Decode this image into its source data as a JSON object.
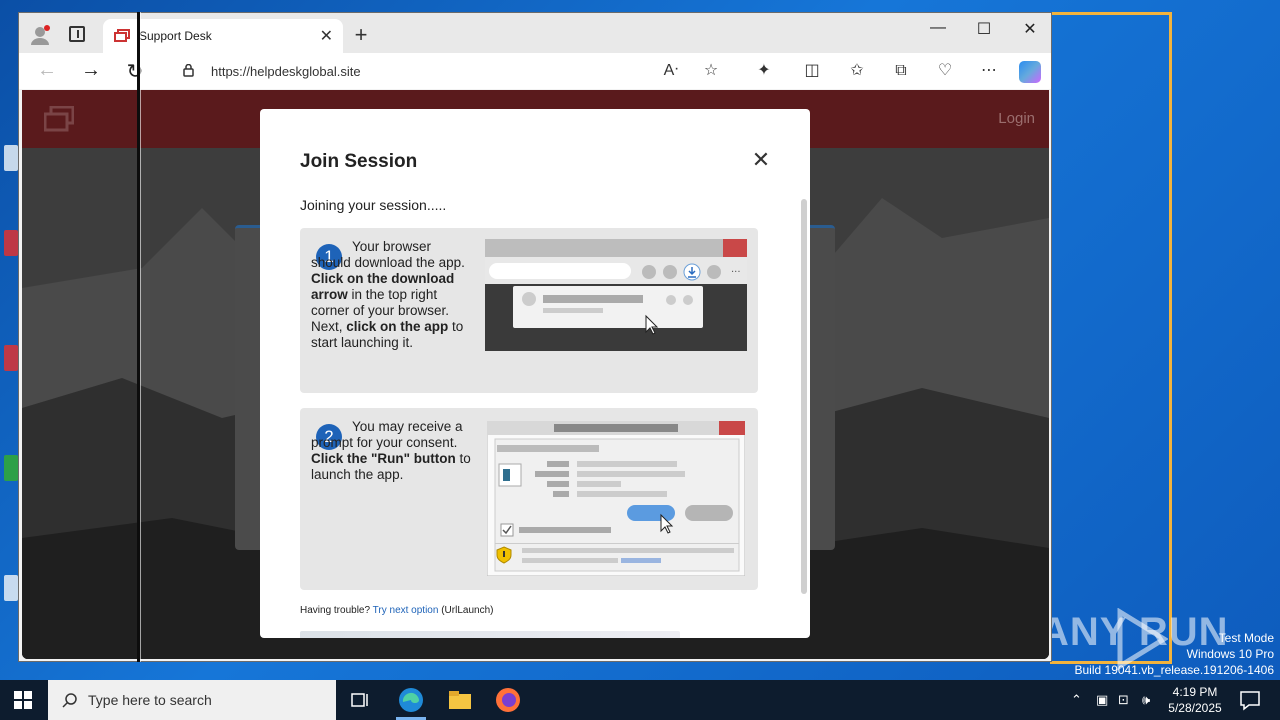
{
  "browser": {
    "tab_title": "Support Desk",
    "url": "https://helpdeskglobal.site",
    "window_controls": [
      "—",
      "☐",
      "✕"
    ]
  },
  "site": {
    "login_label": "Login"
  },
  "modal": {
    "title": "Join Session",
    "close_label": "✕",
    "status": "Joining your session.....",
    "steps": [
      {
        "number": "1",
        "text_parts": [
          "Your browser should download the app. ",
          "Click on the download arrow",
          " in the top right corner of your browser. Next, ",
          "click on the app",
          " to start launching it."
        ]
      },
      {
        "number": "2",
        "text_parts": [
          "You may receive a prompt for your consent. ",
          "Click the \"Run\" button",
          " to launch the app."
        ]
      }
    ],
    "trouble_prefix": "Having trouble?",
    "trouble_link": "Try next option",
    "trouble_suffix": "(UrlLaunch)"
  },
  "taskbar": {
    "search_placeholder": "Type here to search",
    "time": "4:19 PM",
    "date": "5/28/2025"
  },
  "desktop": {
    "watermark": "ANY RUN",
    "test_mode": "Test Mode",
    "os_name": "Windows 10 Pro",
    "build": "Build 19041.vb_release.191206-1406"
  },
  "colors": {
    "step_badge": "#1e63b8",
    "site_header": "#5a1a1c",
    "frame_highlight": "#f2b33d"
  }
}
